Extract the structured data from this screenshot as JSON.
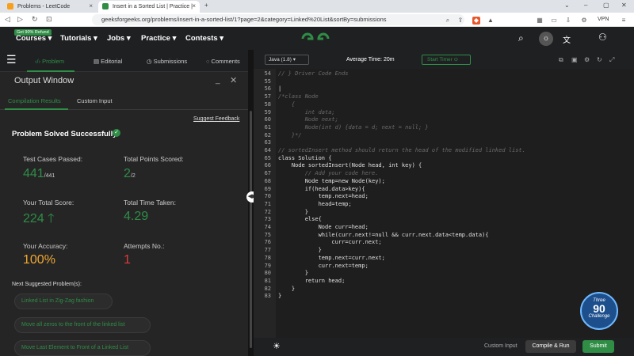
{
  "browser": {
    "tabs": [
      {
        "title": "Problems - LeetCode"
      },
      {
        "title": "Insert in a Sorted List | Practice |"
      }
    ],
    "url": "geeksforgeeks.org/problems/insert-in-a-sorted-list/1?page=2&category=Linked%20List&sortBy=submissions",
    "vpn_label": "VPN"
  },
  "header": {
    "promo": "Get 90% Refund",
    "nav": [
      "Courses",
      "Tutorials",
      "Jobs",
      "Practice",
      "Contests"
    ]
  },
  "problem_tabs": [
    "Problem",
    "Editorial",
    "Submissions",
    "Comments"
  ],
  "output": {
    "title": "Output Window",
    "subtabs": [
      "Compilation Results",
      "Custom Input"
    ],
    "suggest_feedback": "Suggest Feedback",
    "status": "Problem Solved Successfully",
    "stats": {
      "test_cases_label": "Test Cases Passed:",
      "test_cases_value": "441",
      "test_cases_total": "/441",
      "points_label": "Total Points Scored:",
      "points_value": "2",
      "points_total": "/2",
      "score_label": "Your Total Score:",
      "score_value": "224",
      "time_label": "Total Time Taken:",
      "time_value": "4.29",
      "accuracy_label": "Your Accuracy:",
      "accuracy_value": "100%",
      "attempts_label": "Attempts No.:",
      "attempts_value": "1"
    },
    "next_label": "Next Suggested Problem(s):",
    "suggestions": [
      "Linked List in Zig-Zag fashion",
      "Move all zeros to the front of the linked list",
      "Move Last Element to Front of a Linked List"
    ]
  },
  "editor": {
    "language": "Java (1.8)",
    "average_time": "Average Time: 20m",
    "timer_label": "Start Timer",
    "lines": [
      {
        "n": "54",
        "text": "// } Driver Code Ends",
        "comment": true
      },
      {
        "n": "55",
        "text": "",
        "comment": false
      },
      {
        "n": "56",
        "text": "|",
        "comment": false
      },
      {
        "n": "57",
        "text": "/*class Node",
        "comment": true
      },
      {
        "n": "58",
        "text": "    {",
        "comment": true
      },
      {
        "n": "59",
        "text": "        int data;",
        "comment": true
      },
      {
        "n": "60",
        "text": "        Node next;",
        "comment": true
      },
      {
        "n": "61",
        "text": "        Node(int d) {data = d; next = null; }",
        "comment": true
      },
      {
        "n": "62",
        "text": "    }*/",
        "comment": true
      },
      {
        "n": "63",
        "text": "",
        "comment": false
      },
      {
        "n": "64",
        "text": "// sortedInsert method should return the head of the modified linked list.",
        "comment": true
      },
      {
        "n": "65",
        "text": "class Solution {",
        "comment": false
      },
      {
        "n": "66",
        "text": "    Node sortedInsert(Node head, int key) {",
        "comment": false
      },
      {
        "n": "67",
        "text": "        // Add your code here.",
        "comment": true
      },
      {
        "n": "68",
        "text": "        Node temp=new Node(key);",
        "comment": false
      },
      {
        "n": "69",
        "text": "        if(head.data>key){",
        "comment": false
      },
      {
        "n": "70",
        "text": "            temp.next=head;",
        "comment": false
      },
      {
        "n": "71",
        "text": "            head=temp;",
        "comment": false
      },
      {
        "n": "72",
        "text": "        }",
        "comment": false
      },
      {
        "n": "73",
        "text": "        else{",
        "comment": false
      },
      {
        "n": "74",
        "text": "            Node curr=head;",
        "comment": false
      },
      {
        "n": "75",
        "text": "            while(curr.next!=null && curr.next.data<temp.data){",
        "comment": false
      },
      {
        "n": "76",
        "text": "                curr=curr.next;",
        "comment": false
      },
      {
        "n": "77",
        "text": "            }",
        "comment": false
      },
      {
        "n": "78",
        "text": "            temp.next=curr.next;",
        "comment": false
      },
      {
        "n": "79",
        "text": "            curr.next=temp;",
        "comment": false
      },
      {
        "n": "80",
        "text": "        }",
        "comment": false
      },
      {
        "n": "81",
        "text": "        return head;",
        "comment": false
      },
      {
        "n": "82",
        "text": "    }",
        "comment": false
      },
      {
        "n": "83",
        "text": "}",
        "comment": false
      }
    ],
    "custom_input": "Custom Input",
    "compile_label": "Compile & Run",
    "submit_label": "Submit"
  },
  "badge": {
    "line1": "Three",
    "line2": "90",
    "line3": "Challenge"
  },
  "colors": {
    "accent": "#2f8d46",
    "accuracy": "#f0a830",
    "attempts": "#e03b3b"
  }
}
